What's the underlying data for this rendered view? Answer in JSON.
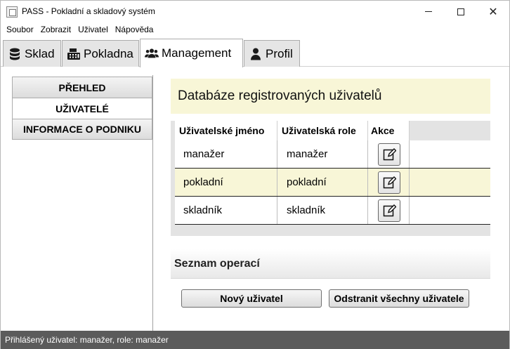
{
  "window": {
    "title": "PASS - Pokladní a skladový systém"
  },
  "menu": [
    "Soubor",
    "Zobrazit",
    "Uživatel",
    "Nápověda"
  ],
  "tabs": [
    {
      "label": "Sklad",
      "icon": "database-icon",
      "active": false
    },
    {
      "label": "Pokladna",
      "icon": "cash-register-icon",
      "active": false
    },
    {
      "label": "Management",
      "icon": "users-icon",
      "active": true
    },
    {
      "label": "Profil",
      "icon": "user-icon",
      "active": false
    }
  ],
  "sidebar": {
    "items": [
      {
        "label": "PŘEHLED",
        "active": false
      },
      {
        "label": "UŽIVATELÉ",
        "active": true
      },
      {
        "label": "INFORMACE O PODNIKU",
        "active": false
      }
    ]
  },
  "main": {
    "heading": "Databáze registrovaných uživatelů",
    "table": {
      "columns": [
        "Uživatelské jméno",
        "Uživatelská role",
        "Akce"
      ],
      "rows": [
        {
          "username": "manažer",
          "role": "manažer",
          "action_icon": "edit-icon"
        },
        {
          "username": "pokladní",
          "role": "pokladní",
          "action_icon": "edit-icon"
        },
        {
          "username": "skladník",
          "role": "skladník",
          "action_icon": "edit-icon"
        }
      ]
    },
    "operations_heading": "Seznam operací",
    "buttons": {
      "new_user": "Nový uživatel",
      "remove_all": "Odstranit všechny uživatele"
    }
  },
  "status": {
    "text": "Přihlášený uživatel: manažer, role: manažer"
  },
  "colors": {
    "highlight": "#f8f6d7",
    "statusbar": "#5b5b5b"
  }
}
